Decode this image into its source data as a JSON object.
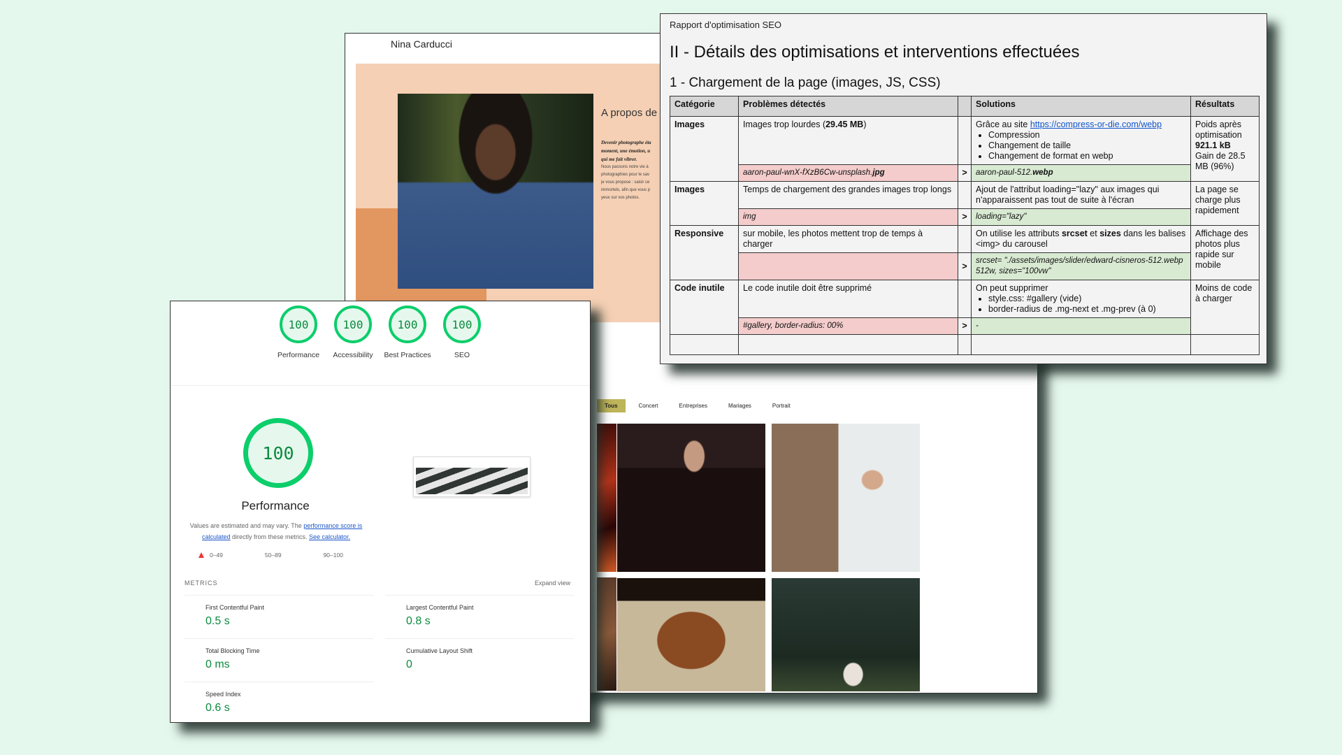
{
  "portfolio": {
    "brand": "Nina Carducci",
    "about_title": "A propos de",
    "about_lead": [
      "Devenir photographe éta",
      "moment, une émotion, u",
      "qui me fait vibrer."
    ],
    "about_body": [
      "Nous passons notre vie à",
      "photographies pour le sav",
      "je vous propose : saisir ce",
      "immortels, afin que vous p",
      "yeux sur vos photos."
    ],
    "filters": [
      {
        "label": "Tous",
        "active": true
      },
      {
        "label": "Concert",
        "active": false
      },
      {
        "label": "Entreprises",
        "active": false
      },
      {
        "label": "Mariages",
        "active": false
      },
      {
        "label": "Portrait",
        "active": false
      }
    ],
    "accent_color": "#beb45a"
  },
  "lighthouse": {
    "scores": [
      {
        "label": "Performance",
        "value": "100"
      },
      {
        "label": "Accessibility",
        "value": "100"
      },
      {
        "label": "Best Practices",
        "value": "100"
      },
      {
        "label": "SEO",
        "value": "100"
      }
    ],
    "main_score": "100",
    "main_title": "Performance",
    "note_prefix": "Values are estimated and may vary. The ",
    "note_link1": "performance score is calculated",
    "note_middle": " directly from these metrics. ",
    "note_link2": "See calculator.",
    "legend": [
      "0–49",
      "50–89",
      "90–100"
    ],
    "metrics_label": "METRICS",
    "expand_label": "Expand view",
    "metrics": [
      {
        "title": "First Contentful Paint",
        "value": "0.5 s"
      },
      {
        "title": "Largest Contentful Paint",
        "value": "0.8 s"
      },
      {
        "title": "Total Blocking Time",
        "value": "0 ms"
      },
      {
        "title": "Cumulative Layout Shift",
        "value": "0"
      },
      {
        "title": "Speed Index",
        "value": "0.6 s"
      }
    ],
    "score_color": "#0cce6b"
  },
  "doc": {
    "header": "Rapport d'optimisation SEO",
    "h1": "II - Détails des optimisations et interventions effectuées",
    "h2": "1 - Chargement de la page (images, JS, CSS)",
    "columns": [
      "Catégorie",
      "Problèmes détectés",
      "",
      "Solutions",
      "Résultats"
    ],
    "rows": [
      {
        "category": "Images",
        "problem_prefix": "Images trop lourdes (",
        "problem_bold": "29.45 MB",
        "problem_suffix": ")",
        "solution_intro": "Grâce au site ",
        "solution_link": "https://compress-or-die.com/webp",
        "solution_items": [
          "Compression",
          "Changement de taille",
          "Changement de format en webp"
        ],
        "before_name": "aaron-paul-wnX-fXzB6Cw-unsplash.",
        "before_ext": "jpg",
        "after_name": "aaron-paul-512.",
        "after_ext": "webp",
        "result_lines": [
          "Poids après optimisation"
        ],
        "result_bold": "921.1 kB",
        "result_tail": "Gain de 28.5 MB (96%)"
      },
      {
        "category": "Images",
        "problem": "Temps de chargement des grandes images trop longs",
        "solution": "Ajout de l'attribut loading=\"lazy\" aux images qui n'apparaissent pas tout de suite à l'écran",
        "before": "img",
        "after": "loading=\"lazy\"",
        "result": "La page se charge plus rapidement"
      },
      {
        "category": "Responsive",
        "problem": "sur mobile, les photos mettent trop de temps à charger",
        "solution_a": "On utilise les attributs ",
        "solution_b1": "srcset",
        "solution_c": " et ",
        "solution_b2": "sizes",
        "solution_d": " dans les balises <img> du carousel",
        "before": "",
        "after": "srcset= \"./assets/images/slider/edward-cisneros-512.webp   512w, sizes=\"100vw\"",
        "result": "Affichage des photos plus rapide sur mobile"
      },
      {
        "category": "Code inutile",
        "problem": "Le code inutile doit être supprimé",
        "solution_intro": "On peut supprimer",
        "solution_items": [
          "style.css: #gallery (vide)",
          "border-radius de .mg-next et .mg-prev (à 0)"
        ],
        "before": "#gallery, border-radius: 00%",
        "after": "-",
        "result": "Moins de code à charger"
      }
    ],
    "arrow": ">"
  }
}
